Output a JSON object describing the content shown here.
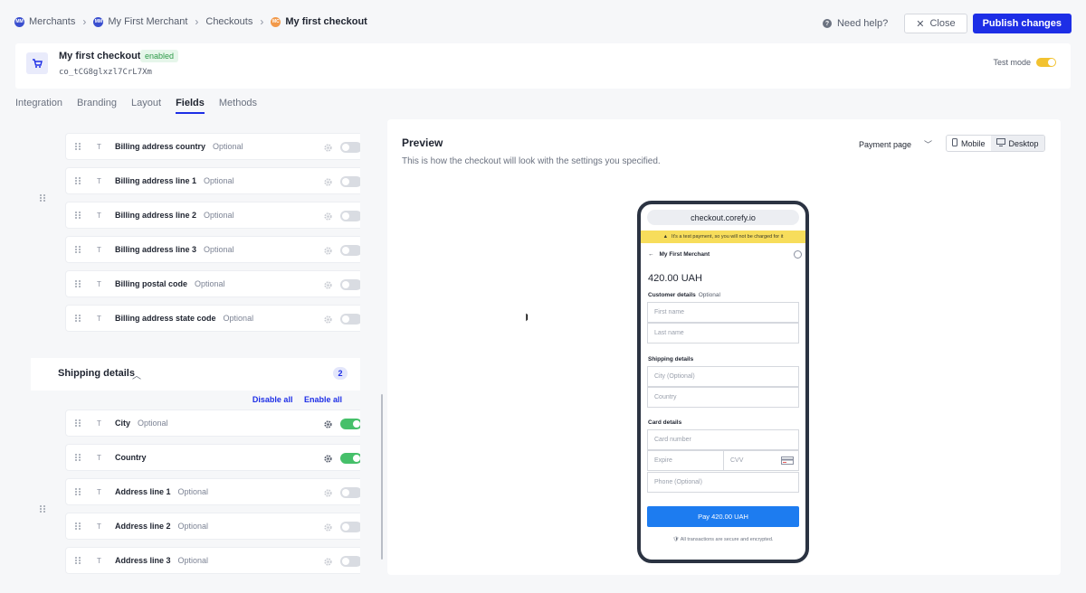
{
  "breadcrumbs": [
    {
      "avatar": "MM",
      "label": "Merchants"
    },
    {
      "avatar": "MM",
      "label": "My First Merchant"
    },
    {
      "label": "Checkouts"
    },
    {
      "avatar": "MC",
      "label": "My first checkout"
    }
  ],
  "header": {
    "help_label": "Need help?",
    "close_label": "Close",
    "publish_label": "Publish changes"
  },
  "checkout": {
    "title": "My first checkout",
    "status": "enabled",
    "id": "co_tCG8glxzl7CrL7Xm",
    "test_mode_label": "Test mode"
  },
  "tabs": [
    {
      "label": "Integration"
    },
    {
      "label": "Branding"
    },
    {
      "label": "Layout"
    },
    {
      "label": "Fields",
      "active": true
    },
    {
      "label": "Methods"
    }
  ],
  "billing_fields": [
    {
      "name": "Billing address country",
      "optional": "Optional",
      "enabled": false
    },
    {
      "name": "Billing address line 1",
      "optional": "Optional",
      "enabled": false
    },
    {
      "name": "Billing address line 2",
      "optional": "Optional",
      "enabled": false
    },
    {
      "name": "Billing address line 3",
      "optional": "Optional",
      "enabled": false
    },
    {
      "name": "Billing postal code",
      "optional": "Optional",
      "enabled": false
    },
    {
      "name": "Billing address state code",
      "optional": "Optional",
      "enabled": false
    }
  ],
  "shipping": {
    "title": "Shipping details",
    "count": "2",
    "disable_all": "Disable all",
    "enable_all": "Enable all",
    "fields": [
      {
        "name": "City",
        "optional": "Optional",
        "enabled": true
      },
      {
        "name": "Country",
        "optional": "",
        "enabled": true
      },
      {
        "name": "Address line 1",
        "optional": "Optional",
        "enabled": false
      },
      {
        "name": "Address line 2",
        "optional": "Optional",
        "enabled": false
      },
      {
        "name": "Address line 3",
        "optional": "Optional",
        "enabled": false
      }
    ]
  },
  "field_type_glyph": "T",
  "preview": {
    "title": "Preview",
    "subtitle": "This is how the checkout will look with the settings you specified.",
    "page_select": "Payment page",
    "mobile_label": "Mobile",
    "desktop_label": "Desktop"
  },
  "phone": {
    "url": "checkout.corefy.io",
    "test_banner": "It's a test payment, so you will not be charged for it",
    "merchant": "My First Merchant",
    "amount": "420.00 UAH",
    "customer_label": "Customer details",
    "customer_optional": "Optional",
    "first_name": "First name",
    "last_name": "Last name",
    "shipping_label": "Shipping details",
    "city": "City (Optional)",
    "country": "Country",
    "card_label": "Card details",
    "card_number": "Card number",
    "expire": "Expire",
    "cvv": "CVV",
    "phone": "Phone (Optional)",
    "pay": "Pay 420.00 UAH",
    "secure": "All transactions are secure and encrypted."
  },
  "colors": {
    "accent": "#1d2ee6",
    "enabled_green": "#46c06a",
    "test_yellow": "#f2c230"
  }
}
